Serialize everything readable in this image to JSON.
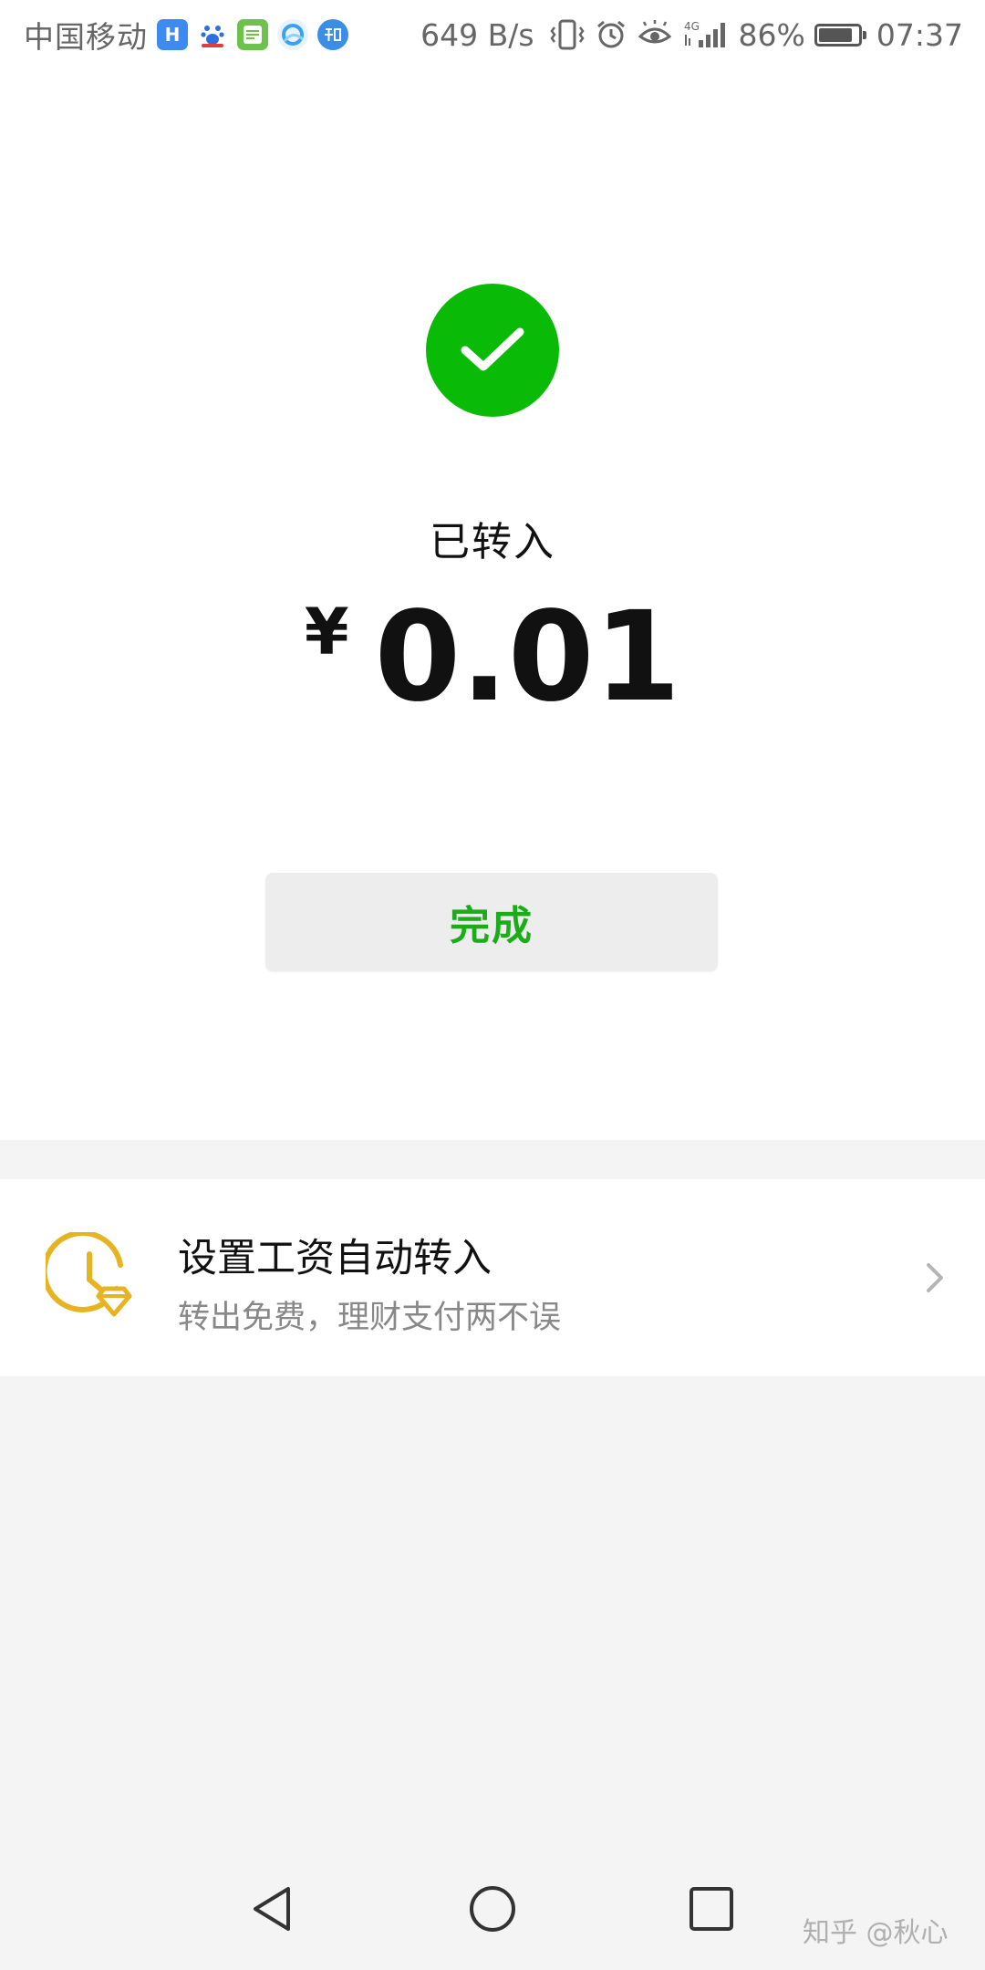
{
  "status_bar": {
    "carrier": "中国移动",
    "net_speed": "649 B/s",
    "network_type": "4G",
    "battery_percent": "86%",
    "battery_level": 0.86,
    "time": "07:37",
    "notification_icons": [
      "app-h-icon",
      "baidu-icon",
      "calendar-app-icon",
      "browser-icon",
      "zhihu-icon"
    ]
  },
  "result": {
    "status_text": "已转入",
    "currency_symbol": "¥",
    "amount": "0.01",
    "done_label": "完成",
    "success_color": "#09bb07",
    "button_text_color": "#1aad19"
  },
  "promo": {
    "title": "设置工资自动转入",
    "subtitle": "转出免费，理财支付两不误",
    "icon": "clock-diamond-icon",
    "icon_color": "#e6b422"
  },
  "watermark": "知乎 @秋心"
}
